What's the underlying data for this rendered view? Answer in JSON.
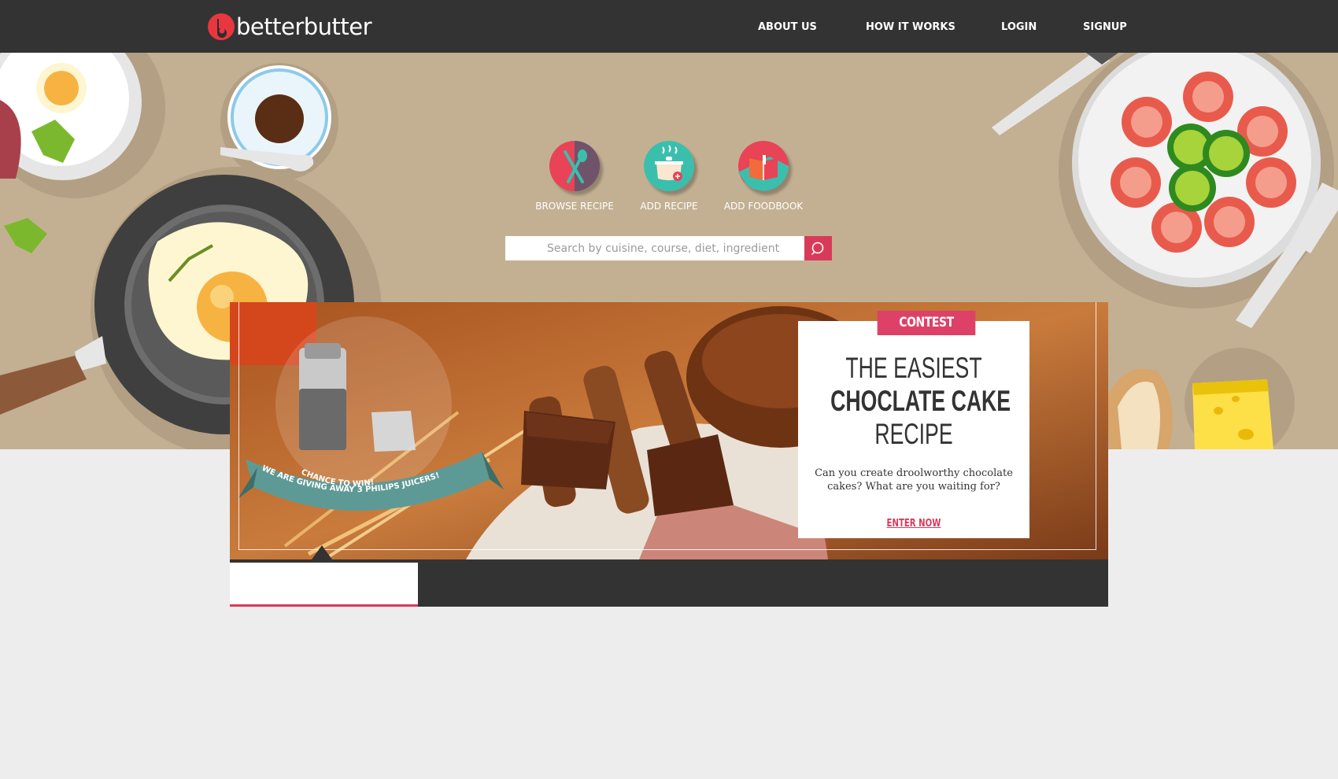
{
  "header": {
    "logo_text": "betterbutter",
    "nav": {
      "about": "ABOUT US",
      "how": "HOW IT WORKS",
      "login": "LOGIN",
      "signup": "SIGNUP"
    }
  },
  "actions": [
    {
      "label": "BROWSE RECIPE",
      "icon": "fork-spoon-icon",
      "color": "#e84357"
    },
    {
      "label": "ADD RECIPE",
      "icon": "cooking-pot-icon",
      "color": "#3bbfad"
    },
    {
      "label": "ADD FOODBOOK",
      "icon": "book-icon",
      "color": "#e84357"
    }
  ],
  "search": {
    "placeholder": "Search by cuisine, course, diet, ingredient",
    "value": ""
  },
  "banner": {
    "promo_line1": "CHANCE TO WIN!",
    "promo_line2": "WE ARE GIVING AWAY 3 PHILIPS JUICERS!",
    "contest_tag": "CONTEST",
    "title_line1": "THE EASIEST",
    "title_line2": "CHOCLATE CAKE",
    "title_line3": "RECIPE",
    "description": "Can you create droolworthy chocolate cakes? What are you waiting for?",
    "cta": "ENTER NOW"
  },
  "colors": {
    "accent": "#d93a5a",
    "header_bg": "#333333",
    "hero_bg": "#c3b093",
    "page_bg": "#ededed"
  }
}
